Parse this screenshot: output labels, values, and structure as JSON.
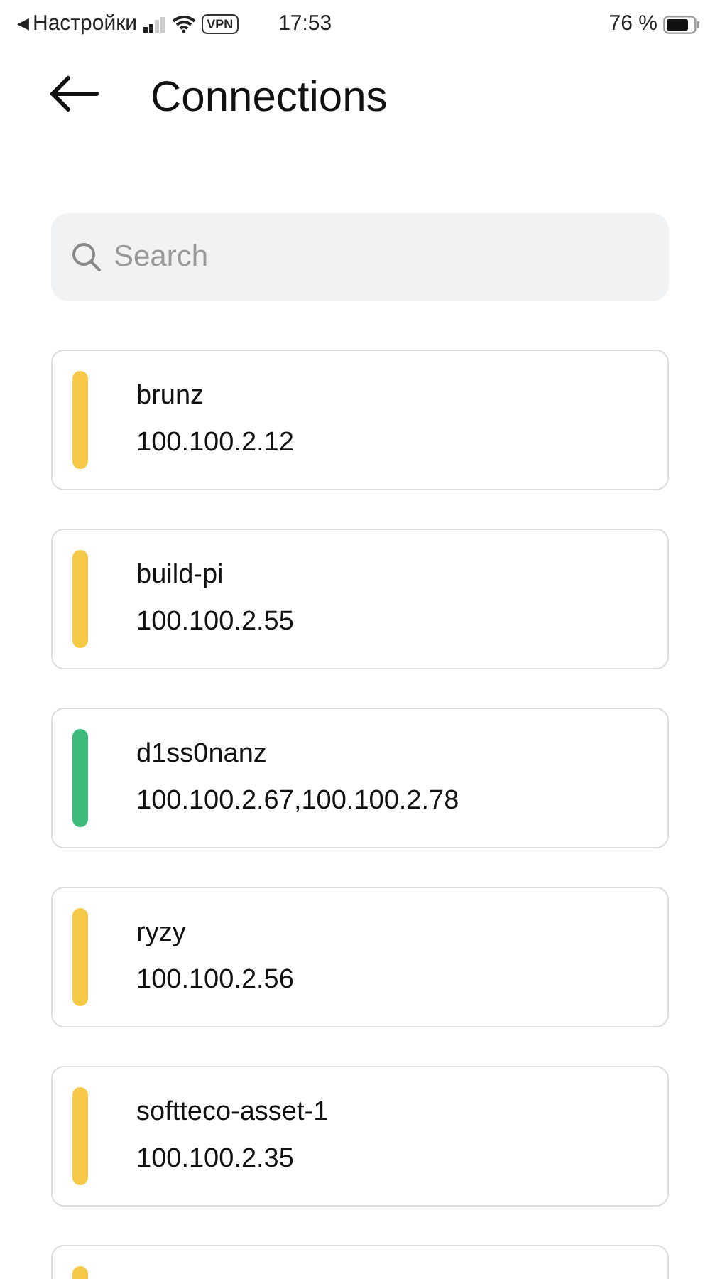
{
  "status_bar": {
    "back_arrow": "◀",
    "back_label": "Настройки",
    "vpn": "VPN",
    "time": "17:53",
    "battery": "76 %"
  },
  "header": {
    "title": "Connections"
  },
  "search": {
    "placeholder": "Search"
  },
  "connections": [
    {
      "name": "brunz",
      "address": "100.100.2.12",
      "color": "#f7c948"
    },
    {
      "name": "build-pi",
      "address": "100.100.2.55",
      "color": "#f7c948"
    },
    {
      "name": "d1ss0nanz",
      "address": "100.100.2.67,100.100.2.78",
      "color": "#3dbb7a"
    },
    {
      "name": "ryzy",
      "address": "100.100.2.56",
      "color": "#f7c948"
    },
    {
      "name": "softteco-asset-1",
      "address": "100.100.2.35",
      "color": "#f7c948"
    },
    {
      "color": "#f7c948"
    }
  ]
}
